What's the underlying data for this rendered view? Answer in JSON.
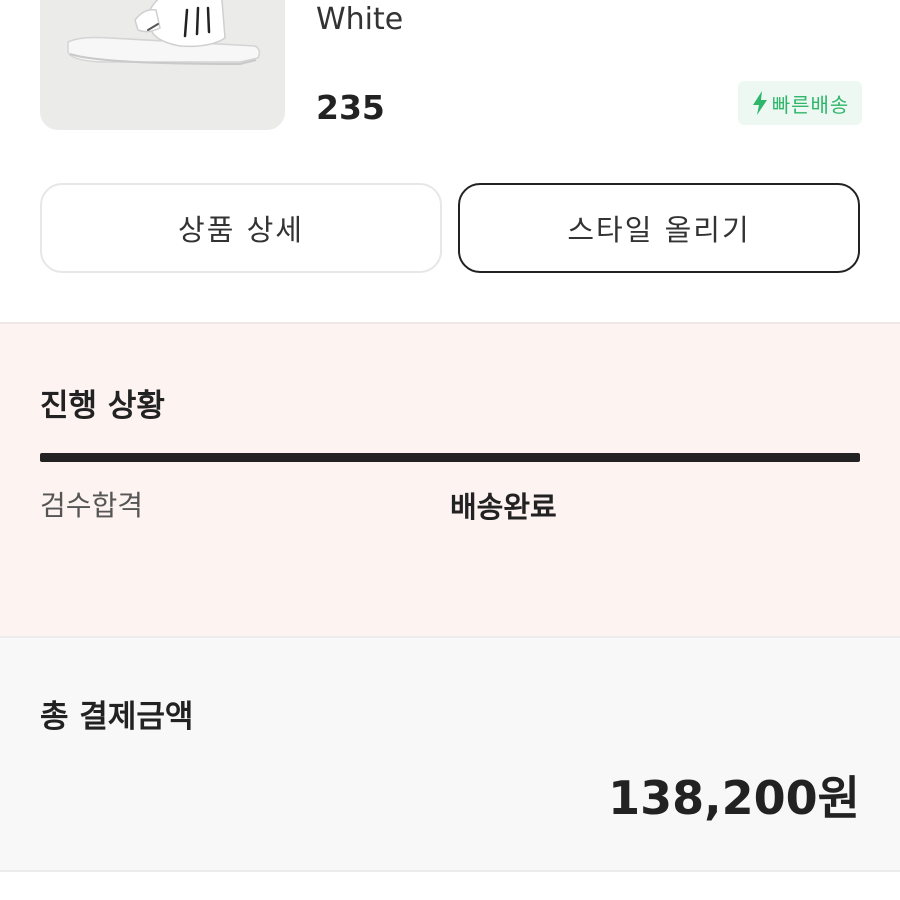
{
  "product": {
    "color": "White",
    "size": "235",
    "badge": {
      "label": "빠른배송",
      "icon": "lightning-bolt-icon",
      "color": "#2fb66a"
    }
  },
  "actions": {
    "detail_label": "상품 상세",
    "style_label": "스타일 올리기"
  },
  "progress": {
    "title": "진행 상황",
    "steps": [
      "검수합격",
      "배송완료"
    ],
    "completion": 1.0
  },
  "payment": {
    "title": "총 결제금액",
    "amount": "138,200원"
  },
  "colors": {
    "progress_background": "#fdf3f1",
    "payment_background": "#f8f8f8",
    "accent": "#222222"
  }
}
